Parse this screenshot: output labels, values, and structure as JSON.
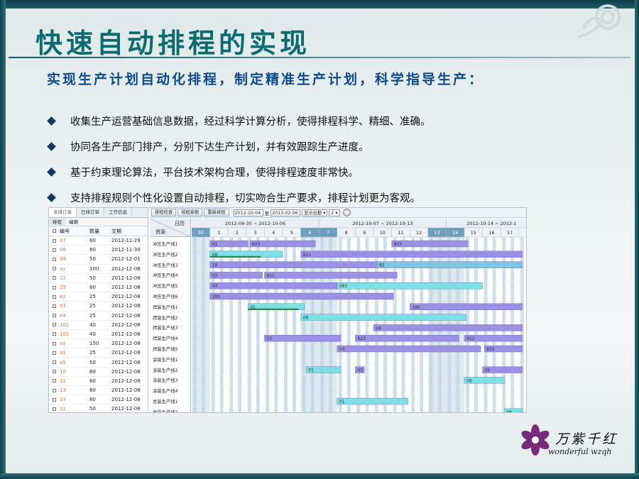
{
  "title": "快速自动排程的实现",
  "subtitle": "实现生产计划自动化排程，制定精准生产计划，科学指导生产：",
  "bullets": [
    "收集生产运营基础信息数据，经过科学计算分析，使得排程科学、精细、准确。",
    "协同各生产部门排产，分别下达生产计划，并有效跟踪生产进度。",
    "基于约束理论算法，平台技术架构合理，使得排程速度非常快。",
    "支持排程规则个性化设置自动排程，切实吻合生产要求，排程计划更为客观。"
  ],
  "logo": {
    "chinese": "万紫千红",
    "latin": "wonderful wzqh",
    "flower_color": "#7a2a7a"
  },
  "app": {
    "tabs": [
      "未排订单",
      "已排订单",
      "工作信息"
    ],
    "subtabs": [
      "排程",
      "编辑"
    ],
    "columns": [
      "编号",
      "数量",
      "交期"
    ],
    "orders": [
      {
        "code": "07",
        "qty": "80",
        "date": "2012-11-29"
      },
      {
        "code": "06",
        "qty": "80",
        "date": "2012-11-30"
      },
      {
        "code": "09",
        "qty": "50",
        "date": "2012-12-01"
      },
      {
        "code": "xx",
        "qty": "100",
        "date": "2012-12-08"
      },
      {
        "code": "22",
        "qty": "50",
        "date": "2012-12-08"
      },
      {
        "code": "25",
        "qty": "80",
        "date": "2012-12-08"
      },
      {
        "code": "e2",
        "qty": "25",
        "date": "2012-12-08"
      },
      {
        "code": "e3",
        "qty": "25",
        "date": "2012-12-08"
      },
      {
        "code": "e4",
        "qty": "25",
        "date": "2012-12-08"
      },
      {
        "code": "101",
        "qty": "40",
        "date": "2012-12-08"
      },
      {
        "code": "102",
        "qty": "40",
        "date": "2012-12-08"
      },
      {
        "code": "xx",
        "qty": "150",
        "date": "2012-12-08"
      },
      {
        "code": "a1",
        "qty": "25",
        "date": "2012-12-08"
      },
      {
        "code": "a5",
        "qty": "50",
        "date": "2012-12-08"
      },
      {
        "code": "10",
        "qty": "80",
        "date": "2012-12-08"
      },
      {
        "code": "12",
        "qty": "80",
        "date": "2012-12-08"
      },
      {
        "code": "13",
        "qty": "80",
        "date": "2012-12-08"
      },
      {
        "code": "14",
        "qty": "80",
        "date": "2012-12-08"
      },
      {
        "code": "11",
        "qty": "50",
        "date": "2012-12-08"
      }
    ],
    "toolbar": {
      "buttons": [
        "排程检查",
        "排程参数",
        "重新排程"
      ],
      "date_from": "2012-10-04",
      "date_sep": "至",
      "date_to": "2013-02-06",
      "mode": "显示出勤",
      "zoom": "2"
    },
    "gantt": {
      "header_top": "日历",
      "header_left": "资源",
      "weeks": [
        "2012-09-30 ~ 2012-10-06",
        "2012-10-07 ~ 2012-10-13",
        "2012-10-14 ~ 2012-1"
      ],
      "days": [
        "30",
        "1",
        "2",
        "3",
        "4",
        "5",
        "6",
        "7",
        "8",
        "9",
        "10",
        "11",
        "12",
        "13",
        "14",
        "15",
        "16",
        "17",
        "1"
      ],
      "highlight_days": [
        "30",
        "6",
        "7",
        "13",
        "14"
      ],
      "resources": [
        "冲压生产线1",
        "冲压生产线2",
        "冲压生产线3",
        "冲压生产线4",
        "冲压生产线5",
        "冲压生产线6",
        "焊装生产线1",
        "焊装生产线2",
        "焊装生产线3",
        "焊装生产线4",
        "焊装生产线5",
        "涂装生产线1",
        "涂装生产线2",
        "涂装生产线3",
        "涂装生产线4",
        "总装生产线1",
        "总装生产线2"
      ],
      "tasks": [
        {
          "row": 0,
          "start": 1,
          "end": 3.1,
          "label": "01",
          "color": "#9b8fe6"
        },
        {
          "row": 0,
          "start": 3.2,
          "end": 6.8,
          "label": "823",
          "color": "#9b8fe6"
        },
        {
          "row": 0,
          "start": 11,
          "end": 15.2,
          "label": "833",
          "color": "#9b8fe6"
        },
        {
          "row": 1,
          "start": 1,
          "end": 5,
          "label": "08",
          "color": "#7ee0e4",
          "progress": 0.7
        },
        {
          "row": 1,
          "start": 6,
          "end": 18.2,
          "label": "811",
          "color": "#9b8fe6"
        },
        {
          "row": 2,
          "start": 1,
          "end": 10.2,
          "label": "18",
          "color": "#9b8fe6"
        },
        {
          "row": 2,
          "start": 10.2,
          "end": 18.2,
          "label": "82",
          "color": "#7ec4e4"
        },
        {
          "row": 3,
          "start": 1,
          "end": 3.9,
          "label": "03",
          "color": "#9b8fe6"
        },
        {
          "row": 3,
          "start": 4,
          "end": 11.3,
          "label": "812",
          "color": "#9b8fe6"
        },
        {
          "row": 4,
          "start": 1,
          "end": 8,
          "label": "04",
          "color": "#9b8fe6"
        },
        {
          "row": 4,
          "start": 8,
          "end": 16,
          "label": "083",
          "color": "#7ee0e4"
        },
        {
          "row": 5,
          "start": 1,
          "end": 11.1,
          "label": "180",
          "color": "#9b8fe6"
        },
        {
          "row": 6,
          "start": 3.1,
          "end": 6.2,
          "label": "01",
          "color": "#7ee0e4",
          "progress": 0.9
        },
        {
          "row": 6,
          "start": 12,
          "end": 18.2,
          "label": "180",
          "color": "#9b8fe6"
        },
        {
          "row": 7,
          "start": 6,
          "end": 15.1,
          "label": "08",
          "color": "#7ee0e4"
        },
        {
          "row": 8,
          "start": 10,
          "end": 18.2,
          "label": "18",
          "color": "#9b8fe6"
        },
        {
          "row": 9,
          "start": 4,
          "end": 8.2,
          "label": "03",
          "color": "#9b8fe6"
        },
        {
          "row": 9,
          "start": 9,
          "end": 14.7,
          "label": "823",
          "color": "#9b8fe6"
        },
        {
          "row": 9,
          "start": 15,
          "end": 18.2,
          "label": "812",
          "color": "#9b8fe6"
        },
        {
          "row": 10,
          "start": 8,
          "end": 15.9,
          "label": "04",
          "color": "#9b8fe6"
        },
        {
          "row": 10,
          "start": 16.1,
          "end": 18.2,
          "label": "833",
          "color": "#9b8fe6"
        },
        {
          "row": 12,
          "start": 6.3,
          "end": 8.2,
          "label": "01",
          "color": "#7ee0e4"
        },
        {
          "row": 12,
          "start": 9,
          "end": 9.5,
          "label": "03",
          "color": "#9b8fe6"
        },
        {
          "row": 12,
          "start": 16,
          "end": 18.2,
          "label": "04",
          "color": "#9b8fe6"
        },
        {
          "row": 13,
          "start": 15,
          "end": 17.2,
          "label": "08",
          "color": "#7ee0e4"
        },
        {
          "row": 15,
          "start": 8,
          "end": 11.9,
          "label": "01",
          "color": "#7ee0e4"
        },
        {
          "row": 16,
          "start": 17.2,
          "end": 18.2,
          "label": "08",
          "color": "#7ee0e4"
        }
      ]
    }
  }
}
